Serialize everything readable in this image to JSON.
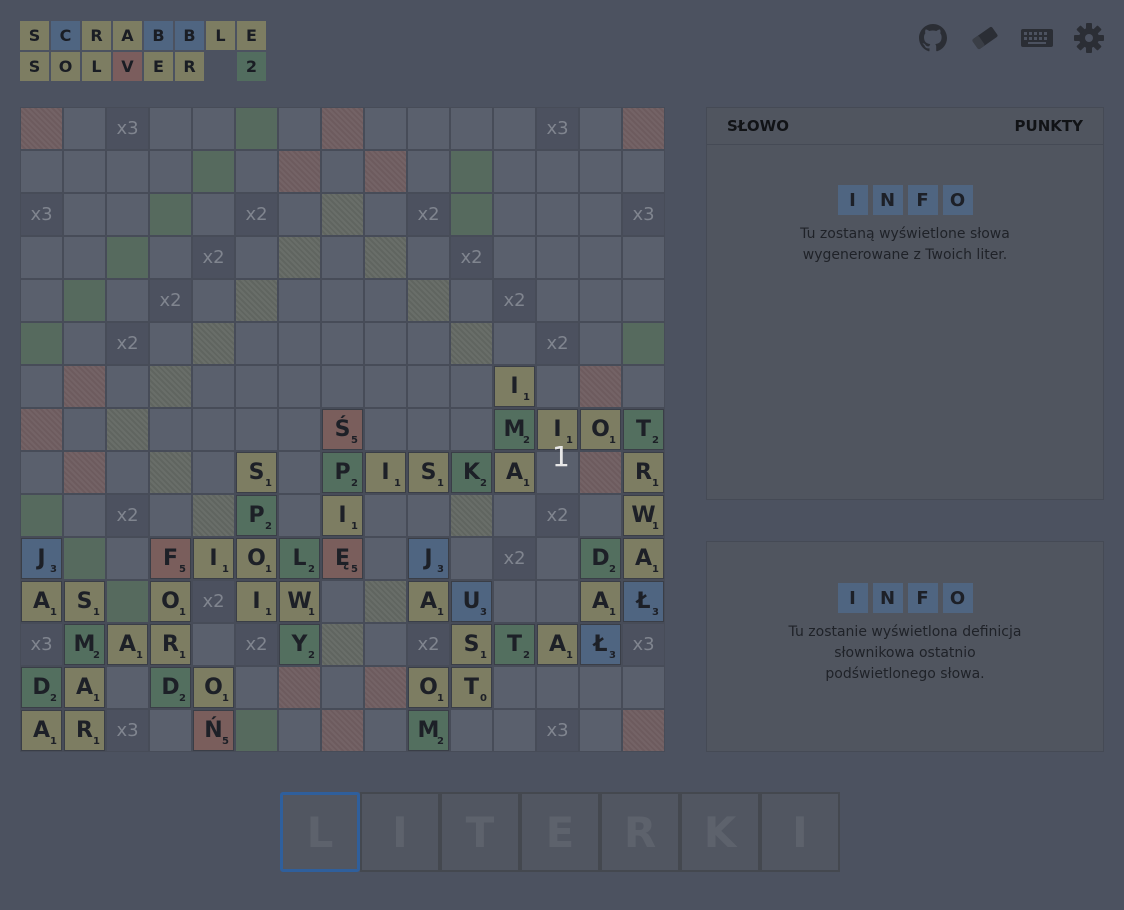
{
  "logo": {
    "row1": [
      {
        "ch": "S",
        "style": "plain"
      },
      {
        "ch": "C",
        "style": "blue"
      },
      {
        "ch": "R",
        "style": "plain"
      },
      {
        "ch": "A",
        "style": "plain"
      },
      {
        "ch": "B",
        "style": "blue"
      },
      {
        "ch": "B",
        "style": "blue"
      },
      {
        "ch": "L",
        "style": "plain"
      },
      {
        "ch": "E",
        "style": "plain"
      }
    ],
    "row2": [
      {
        "ch": "S",
        "style": "plain"
      },
      {
        "ch": "O",
        "style": "plain"
      },
      {
        "ch": "L",
        "style": "plain"
      },
      {
        "ch": "V",
        "style": "red"
      },
      {
        "ch": "E",
        "style": "plain"
      },
      {
        "ch": "R",
        "style": "plain"
      },
      {
        "ch": "",
        "style": "empty"
      },
      {
        "ch": "2",
        "style": "green"
      }
    ]
  },
  "toolbar": {
    "icons": [
      "github-icon",
      "eraser-icon",
      "keyboard-icon",
      "settings-icon"
    ]
  },
  "board": {
    "layout": [
      "rnxnngnrnnnnxnr",
      "nnnngnrnrngnnnn",
      "xnngnxnhnxgnnnx",
      "nngnxnhnhnxnnnn",
      "ngnxnhnnnhnxnnn",
      "gnxnhnnnnnhnxng",
      "nrnhnnnnnnnnnrn",
      "rnhnnnnnnnnnnnr",
      "nrnhnnnnnnnnnrn",
      "gnxnhnnnnnhnxng",
      "ngnxnhnnnhnxnnn",
      "nngnxnhnhnxnnnn",
      "xnngnxnhnxgnnnx",
      "nnnngnrnrngnnnn",
      "rnxnngnrnnnnxnr"
    ],
    "bonus": [
      {
        "r": 0,
        "c": 2,
        "t": "x3"
      },
      {
        "r": 0,
        "c": 12,
        "t": "x3"
      },
      {
        "r": 2,
        "c": 0,
        "t": "x3"
      },
      {
        "r": 2,
        "c": 5,
        "t": "x2"
      },
      {
        "r": 2,
        "c": 9,
        "t": "x2"
      },
      {
        "r": 2,
        "c": 14,
        "t": "x3"
      },
      {
        "r": 3,
        "c": 4,
        "t": "x2"
      },
      {
        "r": 3,
        "c": 10,
        "t": "x2"
      },
      {
        "r": 4,
        "c": 3,
        "t": "x2"
      },
      {
        "r": 4,
        "c": 11,
        "t": "x2"
      },
      {
        "r": 5,
        "c": 2,
        "t": "x2"
      },
      {
        "r": 5,
        "c": 12,
        "t": "x2"
      },
      {
        "r": 9,
        "c": 2,
        "t": "x2"
      },
      {
        "r": 9,
        "c": 12,
        "t": "x2"
      },
      {
        "r": 10,
        "c": 11,
        "t": "x2"
      },
      {
        "r": 11,
        "c": 4,
        "t": "x2"
      },
      {
        "r": 12,
        "c": 0,
        "t": "x3"
      },
      {
        "r": 12,
        "c": 5,
        "t": "x2"
      },
      {
        "r": 12,
        "c": 9,
        "t": "x2"
      },
      {
        "r": 12,
        "c": 14,
        "t": "x3"
      },
      {
        "r": 14,
        "c": 2,
        "t": "x3"
      },
      {
        "r": 14,
        "c": 12,
        "t": "x3"
      }
    ],
    "tiles": [
      {
        "r": 6,
        "c": 11,
        "ch": "I",
        "p": "1",
        "s": "plain"
      },
      {
        "r": 7,
        "c": 7,
        "ch": "Ś",
        "p": "5",
        "s": "red"
      },
      {
        "r": 7,
        "c": 11,
        "ch": "M",
        "p": "2",
        "s": "green"
      },
      {
        "r": 7,
        "c": 12,
        "ch": "I",
        "p": "1",
        "s": "plain"
      },
      {
        "r": 7,
        "c": 13,
        "ch": "O",
        "p": "1",
        "s": "plain"
      },
      {
        "r": 7,
        "c": 14,
        "ch": "T",
        "p": "2",
        "s": "green"
      },
      {
        "r": 8,
        "c": 5,
        "ch": "S",
        "p": "1",
        "s": "plain"
      },
      {
        "r": 8,
        "c": 7,
        "ch": "P",
        "p": "2",
        "s": "green"
      },
      {
        "r": 8,
        "c": 8,
        "ch": "I",
        "p": "1",
        "s": "plain"
      },
      {
        "r": 8,
        "c": 9,
        "ch": "S",
        "p": "1",
        "s": "plain"
      },
      {
        "r": 8,
        "c": 10,
        "ch": "K",
        "p": "2",
        "s": "green"
      },
      {
        "r": 8,
        "c": 11,
        "ch": "A",
        "p": "1",
        "s": "plain"
      },
      {
        "r": 8,
        "c": 14,
        "ch": "R",
        "p": "1",
        "s": "plain"
      },
      {
        "r": 9,
        "c": 5,
        "ch": "P",
        "p": "2",
        "s": "green"
      },
      {
        "r": 9,
        "c": 7,
        "ch": "I",
        "p": "1",
        "s": "plain"
      },
      {
        "r": 9,
        "c": 14,
        "ch": "W",
        "p": "1",
        "s": "plain"
      },
      {
        "r": 10,
        "c": 0,
        "ch": "J",
        "p": "3",
        "s": "blue"
      },
      {
        "r": 10,
        "c": 3,
        "ch": "F",
        "p": "5",
        "s": "red"
      },
      {
        "r": 10,
        "c": 4,
        "ch": "I",
        "p": "1",
        "s": "plain"
      },
      {
        "r": 10,
        "c": 5,
        "ch": "O",
        "p": "1",
        "s": "plain"
      },
      {
        "r": 10,
        "c": 6,
        "ch": "L",
        "p": "2",
        "s": "green"
      },
      {
        "r": 10,
        "c": 7,
        "ch": "Ę",
        "p": "5",
        "s": "red"
      },
      {
        "r": 10,
        "c": 9,
        "ch": "J",
        "p": "3",
        "s": "blue"
      },
      {
        "r": 10,
        "c": 13,
        "ch": "D",
        "p": "2",
        "s": "green"
      },
      {
        "r": 10,
        "c": 14,
        "ch": "A",
        "p": "1",
        "s": "plain"
      },
      {
        "r": 11,
        "c": 0,
        "ch": "A",
        "p": "1",
        "s": "plain"
      },
      {
        "r": 11,
        "c": 1,
        "ch": "S",
        "p": "1",
        "s": "plain"
      },
      {
        "r": 11,
        "c": 3,
        "ch": "O",
        "p": "1",
        "s": "plain"
      },
      {
        "r": 11,
        "c": 5,
        "ch": "I",
        "p": "1",
        "s": "plain"
      },
      {
        "r": 11,
        "c": 6,
        "ch": "W",
        "p": "1",
        "s": "plain"
      },
      {
        "r": 11,
        "c": 9,
        "ch": "A",
        "p": "1",
        "s": "plain"
      },
      {
        "r": 11,
        "c": 10,
        "ch": "U",
        "p": "3",
        "s": "blue"
      },
      {
        "r": 11,
        "c": 13,
        "ch": "A",
        "p": "1",
        "s": "plain"
      },
      {
        "r": 11,
        "c": 14,
        "ch": "Ł",
        "p": "3",
        "s": "blue"
      },
      {
        "r": 12,
        "c": 1,
        "ch": "M",
        "p": "2",
        "s": "green"
      },
      {
        "r": 12,
        "c": 2,
        "ch": "A",
        "p": "1",
        "s": "plain"
      },
      {
        "r": 12,
        "c": 3,
        "ch": "R",
        "p": "1",
        "s": "plain"
      },
      {
        "r": 12,
        "c": 6,
        "ch": "Y",
        "p": "2",
        "s": "green"
      },
      {
        "r": 12,
        "c": 10,
        "ch": "S",
        "p": "1",
        "s": "plain"
      },
      {
        "r": 12,
        "c": 11,
        "ch": "T",
        "p": "2",
        "s": "green"
      },
      {
        "r": 12,
        "c": 12,
        "ch": "A",
        "p": "1",
        "s": "plain"
      },
      {
        "r": 12,
        "c": 13,
        "ch": "Ł",
        "p": "3",
        "s": "blue"
      },
      {
        "r": 13,
        "c": 0,
        "ch": "D",
        "p": "2",
        "s": "green"
      },
      {
        "r": 13,
        "c": 1,
        "ch": "A",
        "p": "1",
        "s": "plain"
      },
      {
        "r": 13,
        "c": 3,
        "ch": "D",
        "p": "2",
        "s": "green"
      },
      {
        "r": 13,
        "c": 4,
        "ch": "O",
        "p": "1",
        "s": "plain"
      },
      {
        "r": 13,
        "c": 9,
        "ch": "O",
        "p": "1",
        "s": "plain"
      },
      {
        "r": 13,
        "c": 10,
        "ch": "T",
        "p": "0",
        "s": "plain"
      },
      {
        "r": 14,
        "c": 0,
        "ch": "A",
        "p": "1",
        "s": "plain"
      },
      {
        "r": 14,
        "c": 1,
        "ch": "R",
        "p": "1",
        "s": "plain"
      },
      {
        "r": 14,
        "c": 4,
        "ch": "Ń",
        "p": "5",
        "s": "red"
      },
      {
        "r": 14,
        "c": 9,
        "ch": "M",
        "p": "2",
        "s": "green"
      }
    ],
    "overlay_number": "1"
  },
  "results_panel": {
    "col_word": "SŁOWO",
    "col_points": "PUNKTY",
    "info_letters": [
      "I",
      "N",
      "F",
      "O"
    ],
    "info_text_1": "Tu zostaną wyświetlone słowa",
    "info_text_2": "wygenerowane z Twoich liter."
  },
  "definition_panel": {
    "info_letters": [
      "I",
      "N",
      "F",
      "O"
    ],
    "info_text_1": "Tu zostanie wyświetlona definicja",
    "info_text_2": "słownikowa ostatnio",
    "info_text_3": "podświetlonego słowa."
  },
  "letters_input": {
    "placeholder_letters": [
      "L",
      "I",
      "T",
      "E",
      "R",
      "K",
      "I"
    ],
    "active_index": 0
  }
}
